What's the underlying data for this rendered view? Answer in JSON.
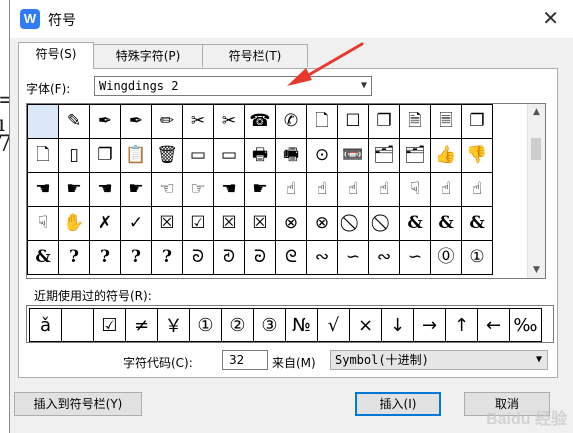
{
  "background": {
    "glyphs": [
      "=",
      "ı",
      "7"
    ]
  },
  "window": {
    "title": "符号",
    "app_icon": "W"
  },
  "tabs": [
    {
      "label": "符号(S)"
    },
    {
      "label": "特殊字符(P)"
    },
    {
      "label": "符号栏(T)"
    }
  ],
  "font": {
    "label": "字体(F):",
    "value": "Wingdings 2"
  },
  "symbol_grid": [
    [
      "",
      "✎",
      "✒",
      "✒",
      "✏",
      "✂",
      "✂",
      "☎",
      "✆",
      "🗋",
      "☐",
      "❐",
      "🗎",
      "🗏",
      "❐"
    ],
    [
      "🗋",
      "▯",
      "❐",
      "📋",
      "🗑",
      "▭",
      "▭",
      "🖶",
      "🖷",
      "⊙",
      "📼",
      "🗂",
      "🗂",
      "👍",
      "👎"
    ],
    [
      "☚",
      "☛",
      "☚",
      "☛",
      "☜",
      "☞",
      "☚",
      "☛",
      "☝",
      "☝",
      "☝",
      "☝",
      "☟",
      "☝",
      "☝"
    ],
    [
      "☟",
      "✋",
      "✗",
      "✓",
      "☒",
      "☑",
      "☒",
      "☒",
      "⊗",
      "⊗",
      "⃠",
      "⃠",
      "&",
      "&",
      "&"
    ],
    [
      "&",
      "?",
      "?",
      "?",
      "?",
      "ᘐ",
      "ᘑ",
      "ᘒ",
      "ᘓ",
      "∾",
      "∽",
      "∾",
      "∽",
      "⓪",
      "①"
    ]
  ],
  "recent": {
    "label": "近期使用过的符号(R):",
    "symbols": [
      "ǎ",
      "",
      "☑",
      "≠",
      "￥",
      "①",
      "②",
      "③",
      "№",
      "√",
      "×",
      "↓",
      "→",
      "↑",
      "←",
      "‰"
    ]
  },
  "char_code": {
    "label": "字符代码(C):",
    "value": "32"
  },
  "from": {
    "label": "来自(M)",
    "value": "Symbol(十进制)"
  },
  "buttons": {
    "insert_to_bar": "插入到符号栏(Y)",
    "insert": "插入(I)",
    "cancel": "取消"
  },
  "watermark": "Baidu 经验",
  "colors": {
    "accent": "#0078d7",
    "annotation_arrow": "#e8392d",
    "selection": "#dbe8f8"
  }
}
